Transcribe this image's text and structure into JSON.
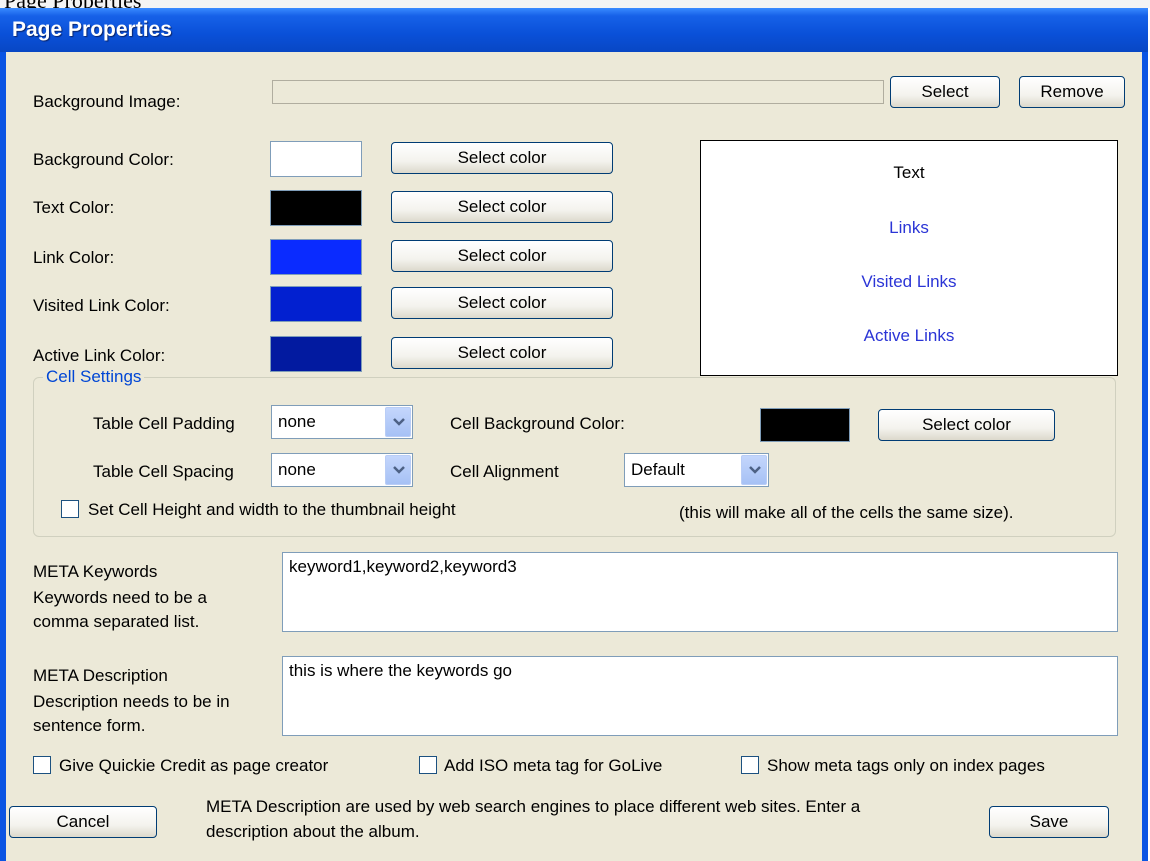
{
  "window": {
    "title": "Page Properties",
    "above_title_fragment": "Page Properties"
  },
  "background_image": {
    "label": "Background Image:",
    "value": "",
    "select_label": "Select",
    "remove_label": "Remove"
  },
  "colors": {
    "background": {
      "label": "Background Color:",
      "swatch": "#ffffff",
      "button": "Select color"
    },
    "text": {
      "label": "Text Color:",
      "swatch": "#000000",
      "button": "Select color"
    },
    "link": {
      "label": "Link Color:",
      "swatch": "#0a2bff",
      "button": "Select color"
    },
    "visited": {
      "label": "Visited Link Color:",
      "swatch": "#0220d0",
      "button": "Select color"
    },
    "active": {
      "label": "Active Link Color:",
      "swatch": "#021aa0",
      "button": "Select color"
    }
  },
  "preview": {
    "text": "Text",
    "links": "Links",
    "visited": "Visited Links",
    "active": "Active Links",
    "link_color": "#2b35d6"
  },
  "cell_settings": {
    "title": "Cell Settings",
    "padding_label": "Table Cell Padding",
    "padding_value": "none",
    "spacing_label": "Table Cell Spacing",
    "spacing_value": "none",
    "bg_label": "Cell Background Color:",
    "bg_swatch": "#000000",
    "bg_button": "Select color",
    "align_label": "Cell Alignment",
    "align_value": "Default",
    "thumb_label": "Set Cell Height and width to the thumbnail height",
    "thumb_note": "(this will make all of the cells the same size)."
  },
  "meta_keywords": {
    "label": "META Keywords",
    "hint1": "Keywords need to be a",
    "hint2": "comma separated list.",
    "value": "keyword1,keyword2,keyword3"
  },
  "meta_description": {
    "label": "META Description",
    "hint1": "Description needs to be in",
    "hint2": "sentence form.",
    "value": "this is where the keywords go"
  },
  "options": {
    "credit": "Give Quickie Credit as page creator",
    "iso": "Add ISO meta tag for GoLive",
    "index_only": "Show meta tags only on index pages"
  },
  "footer": {
    "cancel": "Cancel",
    "save": "Save",
    "info1": "META Description are used by web search engines to place different web sites. Enter a",
    "info2": "description about the album."
  }
}
